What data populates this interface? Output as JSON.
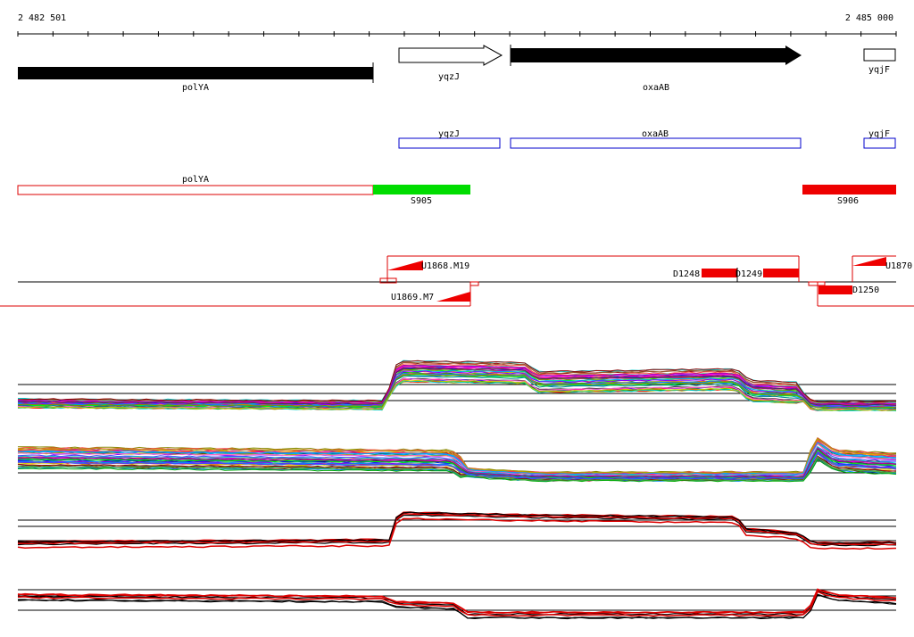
{
  "coordinates": {
    "start_label": "2 482 501",
    "end_label": "2 485 000"
  },
  "genes_top": [
    {
      "name": "polYA",
      "strand": "-",
      "style": "filled"
    },
    {
      "name": "yqzJ",
      "strand": "+",
      "style": "outline"
    },
    {
      "name": "oxaAB",
      "strand": "+",
      "style": "filled"
    },
    {
      "name": "yqjF",
      "strand": "+",
      "style": "outline"
    }
  ],
  "features_plus": [
    {
      "name": "yqzJ",
      "color": "#0000cc"
    },
    {
      "name": "oxaAB",
      "color": "#0000cc"
    },
    {
      "name": "yqjF",
      "color": "#0000cc"
    }
  ],
  "features_minus": [
    {
      "name": "polYA",
      "color": "#dd0000",
      "style": "outline"
    },
    {
      "name": "S905",
      "color": "#00dd00",
      "style": "filled"
    },
    {
      "name": "S906",
      "color": "#ee0000",
      "style": "filled"
    }
  ],
  "transcript_labels": {
    "u1868": "U1868.M19",
    "u1869": "U1869.M7",
    "u1870": "U1870",
    "d1248": "D1248",
    "d1249": "D1249",
    "d1250": "D1250"
  },
  "colors": {
    "gene": "#000000",
    "plus_outline": "#0000cc",
    "minus_outline": "#dd0000",
    "segment_green": "#00dd00",
    "segment_red": "#ee0000",
    "transcript_line": "#dd0000"
  },
  "expression_panels": [
    {
      "id": "plus-all-conditions",
      "style": "multicolor"
    },
    {
      "id": "minus-all-conditions",
      "style": "multicolor"
    },
    {
      "id": "plus-selected",
      "style": "black-red"
    },
    {
      "id": "minus-selected",
      "style": "black-red"
    }
  ]
}
